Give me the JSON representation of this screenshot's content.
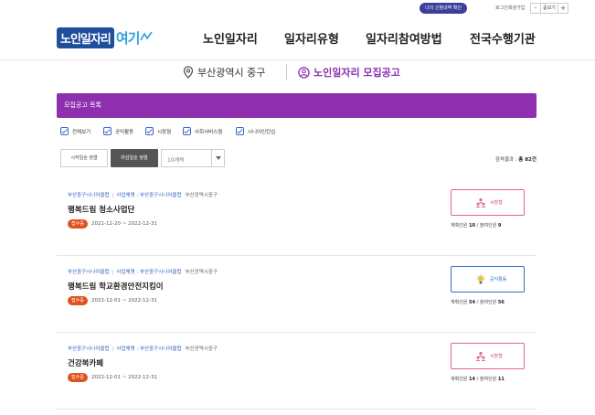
{
  "topbar": {
    "senior_pill": "나의 신청내역 확인",
    "login": "로그인",
    "signup": "회원가입",
    "zoom_out": "-",
    "zoom_label": "돋보기",
    "zoom_in": "+"
  },
  "header": {
    "logo_main": "노인일자리",
    "logo_sub": "여기",
    "nav": [
      {
        "label": "노인일자리"
      },
      {
        "label": "일자리유형"
      },
      {
        "label": "일자리참여방법"
      },
      {
        "label": "전국수행기관"
      }
    ]
  },
  "location": {
    "region": "부산광역시 중구",
    "section": "노인일자리 모집공고"
  },
  "banner": {
    "title": "모집공고 목록"
  },
  "filters": [
    {
      "label": "전체보기"
    },
    {
      "label": "공익활동"
    },
    {
      "label": "시장형"
    },
    {
      "label": "사회서비스형"
    },
    {
      "label": "시니어인턴십"
    }
  ],
  "sort": {
    "start_date": "시작일순 정렬",
    "end_date": "마감일순 정렬",
    "page_size": "10개씩",
    "result_prefix": "검색결과 :",
    "result_count": "총 82건"
  },
  "jobs": [
    {
      "org": "부산중구시니어클럽",
      "biz_label": "사업체명 : 부산중구시니어클럽",
      "place": "부산광역시중구",
      "title": "행복드림 청소사업단",
      "status": "접수중",
      "period": "2021-12-20 ~ 2022-12-31",
      "category": "시장형",
      "category_style": "pink",
      "planned_label": "계획인원",
      "planned": "10",
      "joined_label": "참여인원",
      "joined": "9"
    },
    {
      "org": "부산중구시니어클럽",
      "biz_label": "사업체명 : 부산중구시니어클럽",
      "place": "부산광역시중구",
      "title": "행복드림 학교환경안전지킴이",
      "status": "접수중",
      "period": "2022-12-01 ~ 2022-12-31",
      "category": "공익활동",
      "category_style": "blue",
      "planned_label": "계획인원",
      "planned": "54",
      "joined_label": "참여인원",
      "joined": "56"
    },
    {
      "org": "부산중구시니어클럽",
      "biz_label": "사업체명 : 부산중구시니어클럽",
      "place": "부산광역시중구",
      "title": "건강복카페",
      "status": "접수중",
      "period": "2022-12-01 ~ 2022-12-31",
      "category": "시장형",
      "category_style": "pink",
      "planned_label": "계획인원",
      "planned": "14",
      "joined_label": "참여인원",
      "joined": "11"
    }
  ],
  "colors": {
    "brand_purple": "#8d2fae",
    "logo_blue": "#1d4f9c",
    "status_orange": "#e0521e",
    "market_pink": "#e4677d",
    "public_blue": "#2f73c4"
  }
}
